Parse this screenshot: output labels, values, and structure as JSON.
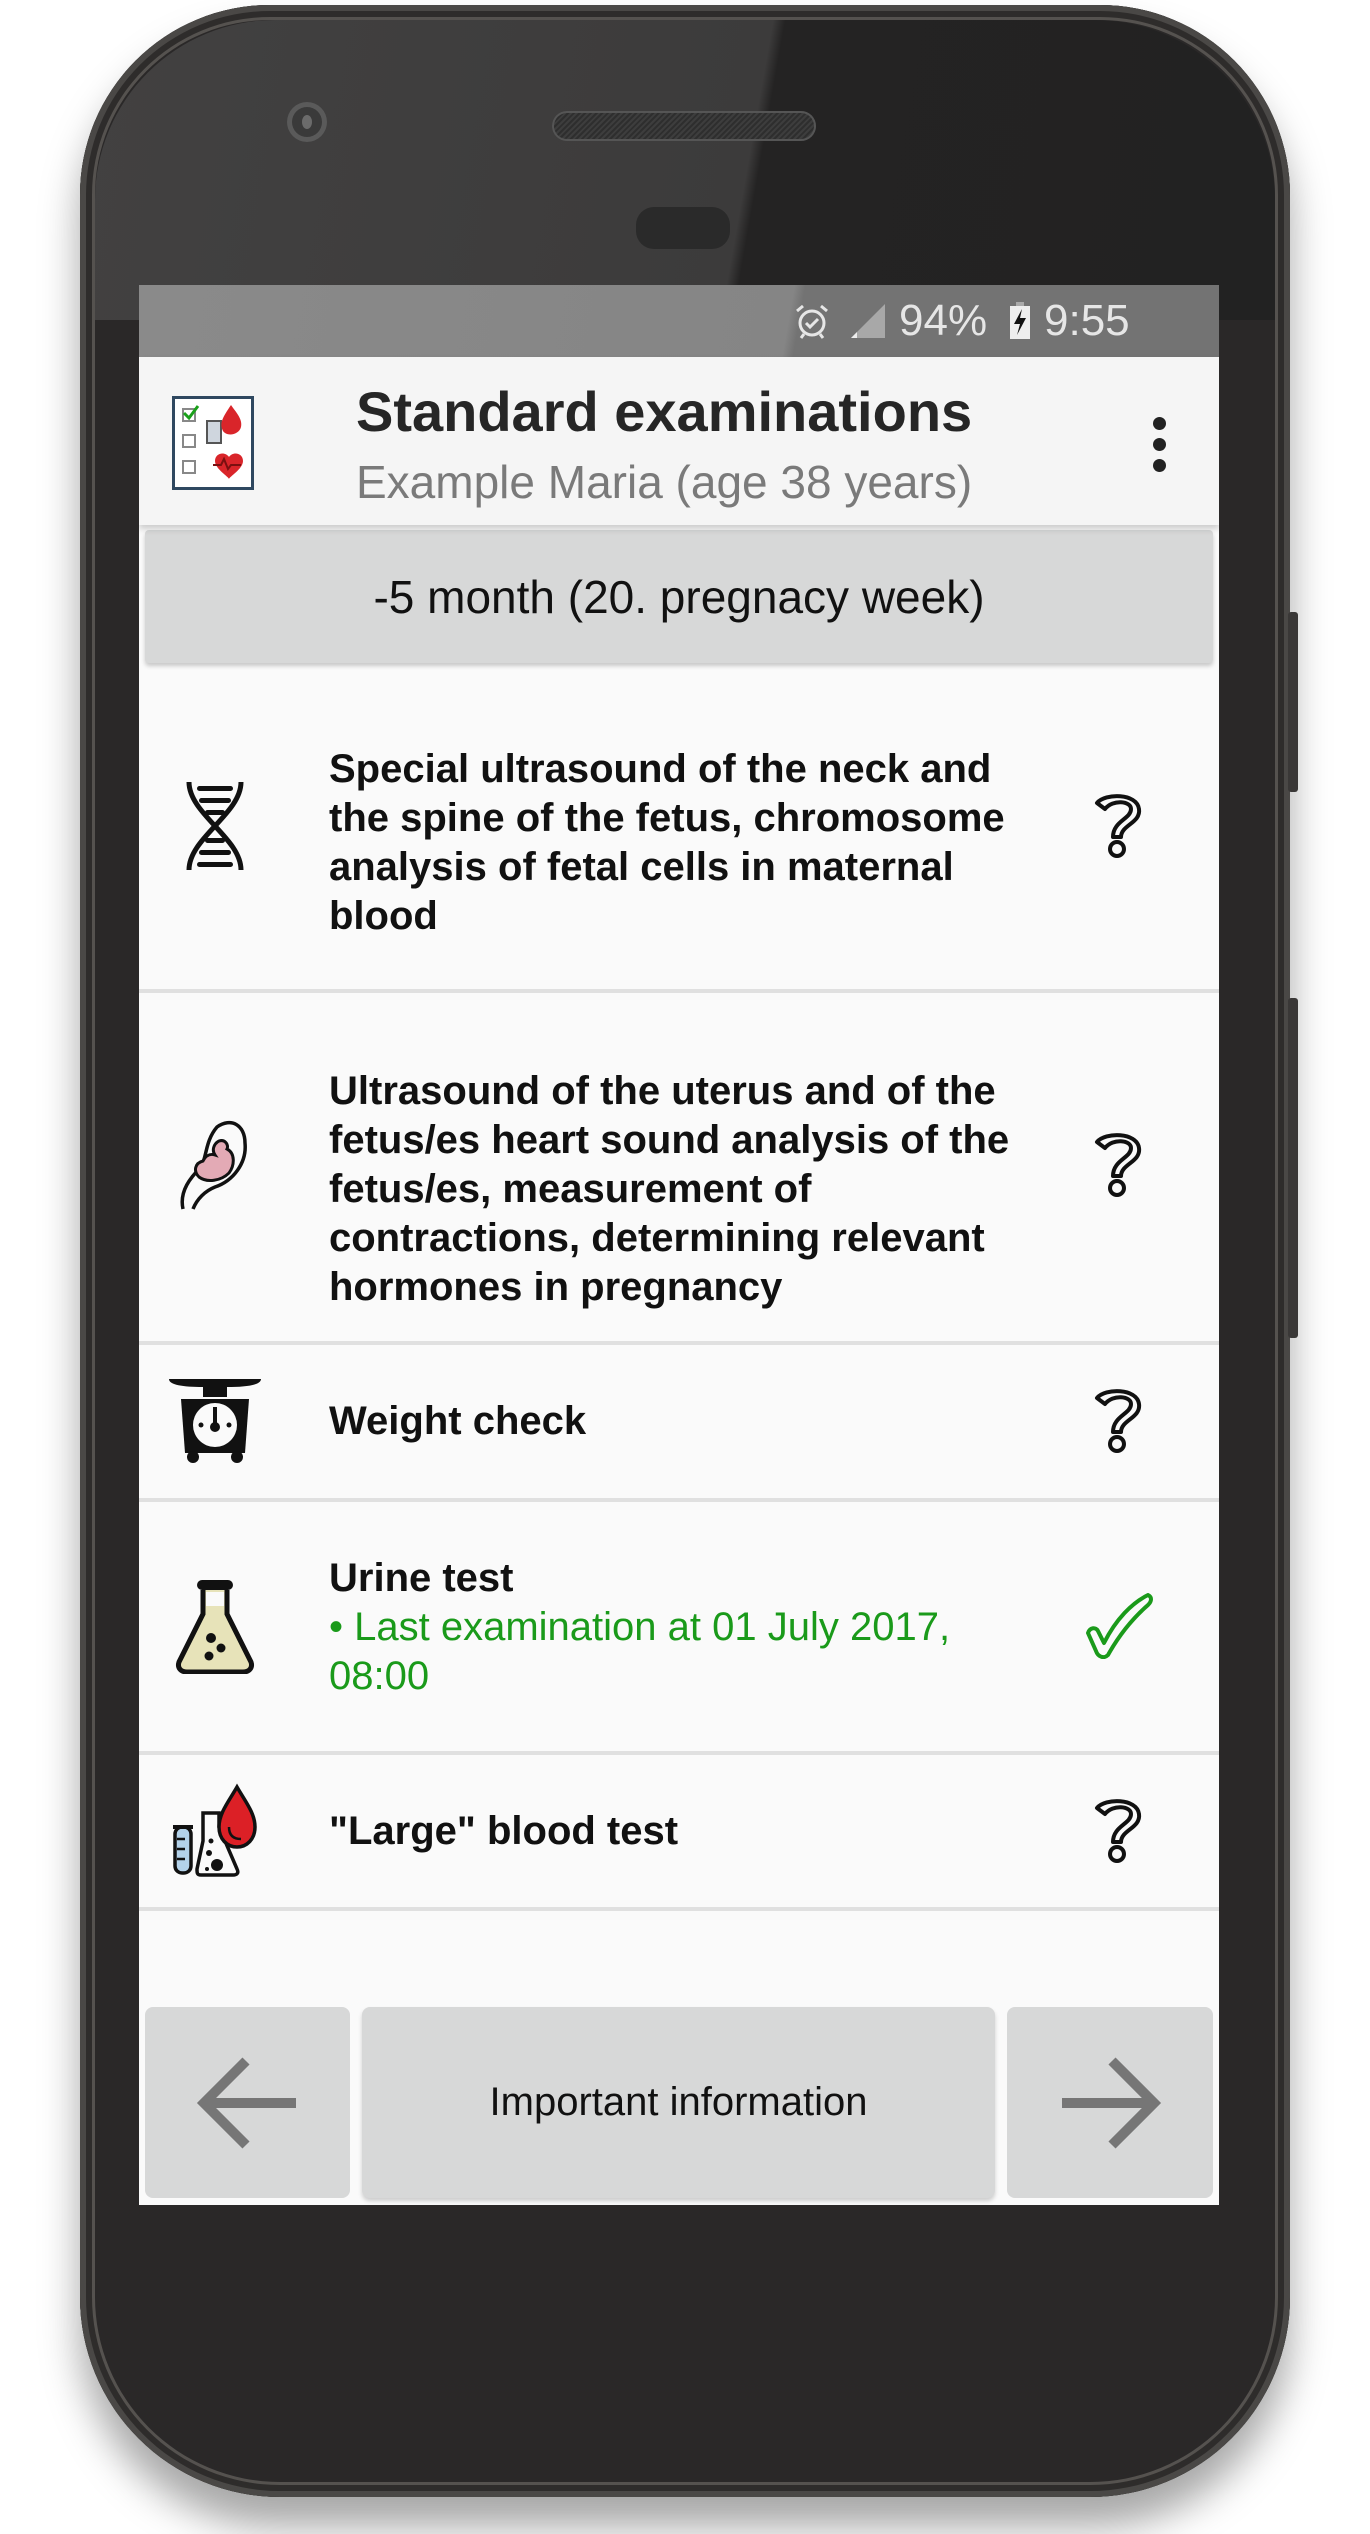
{
  "status_bar": {
    "alarm_icon": "alarm-clock-icon",
    "signal_icon": "signal-icon",
    "battery_percent": "94%",
    "battery_icon": "battery-charging-icon",
    "time": "9:55"
  },
  "app_bar": {
    "logo_icon": "checklist-logo-icon",
    "title": "Standard examinations",
    "subtitle": "Example Maria (age 38 years)",
    "menu_icon": "more-vert-icon"
  },
  "period_header": "-5 month (20. pregnacy week)",
  "examinations": [
    {
      "icon": "dna-icon",
      "title": "Special ultrasound of the neck and the spine of the fetus, chromosome analysis of fetal cells in maternal blood",
      "status": "unknown",
      "status_icon": "question-mark-icon"
    },
    {
      "icon": "fetus-icon",
      "title": "Ultrasound of the uterus and of the fetus/es heart sound analysis of the fetus/es, measurement of contractions, determining relevant hormones in pregnancy",
      "status": "unknown",
      "status_icon": "question-mark-icon"
    },
    {
      "icon": "scale-icon",
      "title": "Weight check",
      "status": "unknown",
      "status_icon": "question-mark-icon"
    },
    {
      "icon": "flask-icon",
      "title": "Urine test",
      "detail": "• Last examination at 01 July 2017, 08:00",
      "status": "done",
      "status_icon": "checkmark-icon"
    },
    {
      "icon": "blood-test-icon",
      "title": "\"Large\" blood test",
      "status": "unknown",
      "status_icon": "question-mark-icon"
    }
  ],
  "bottom_nav": {
    "back_icon": "arrow-left-icon",
    "info_label": "Important information",
    "forward_icon": "arrow-right-icon"
  },
  "colors": {
    "done_green": "#1a9a1a",
    "band_gray": "#d7d8d8",
    "status_bar_gray": "#808080"
  }
}
